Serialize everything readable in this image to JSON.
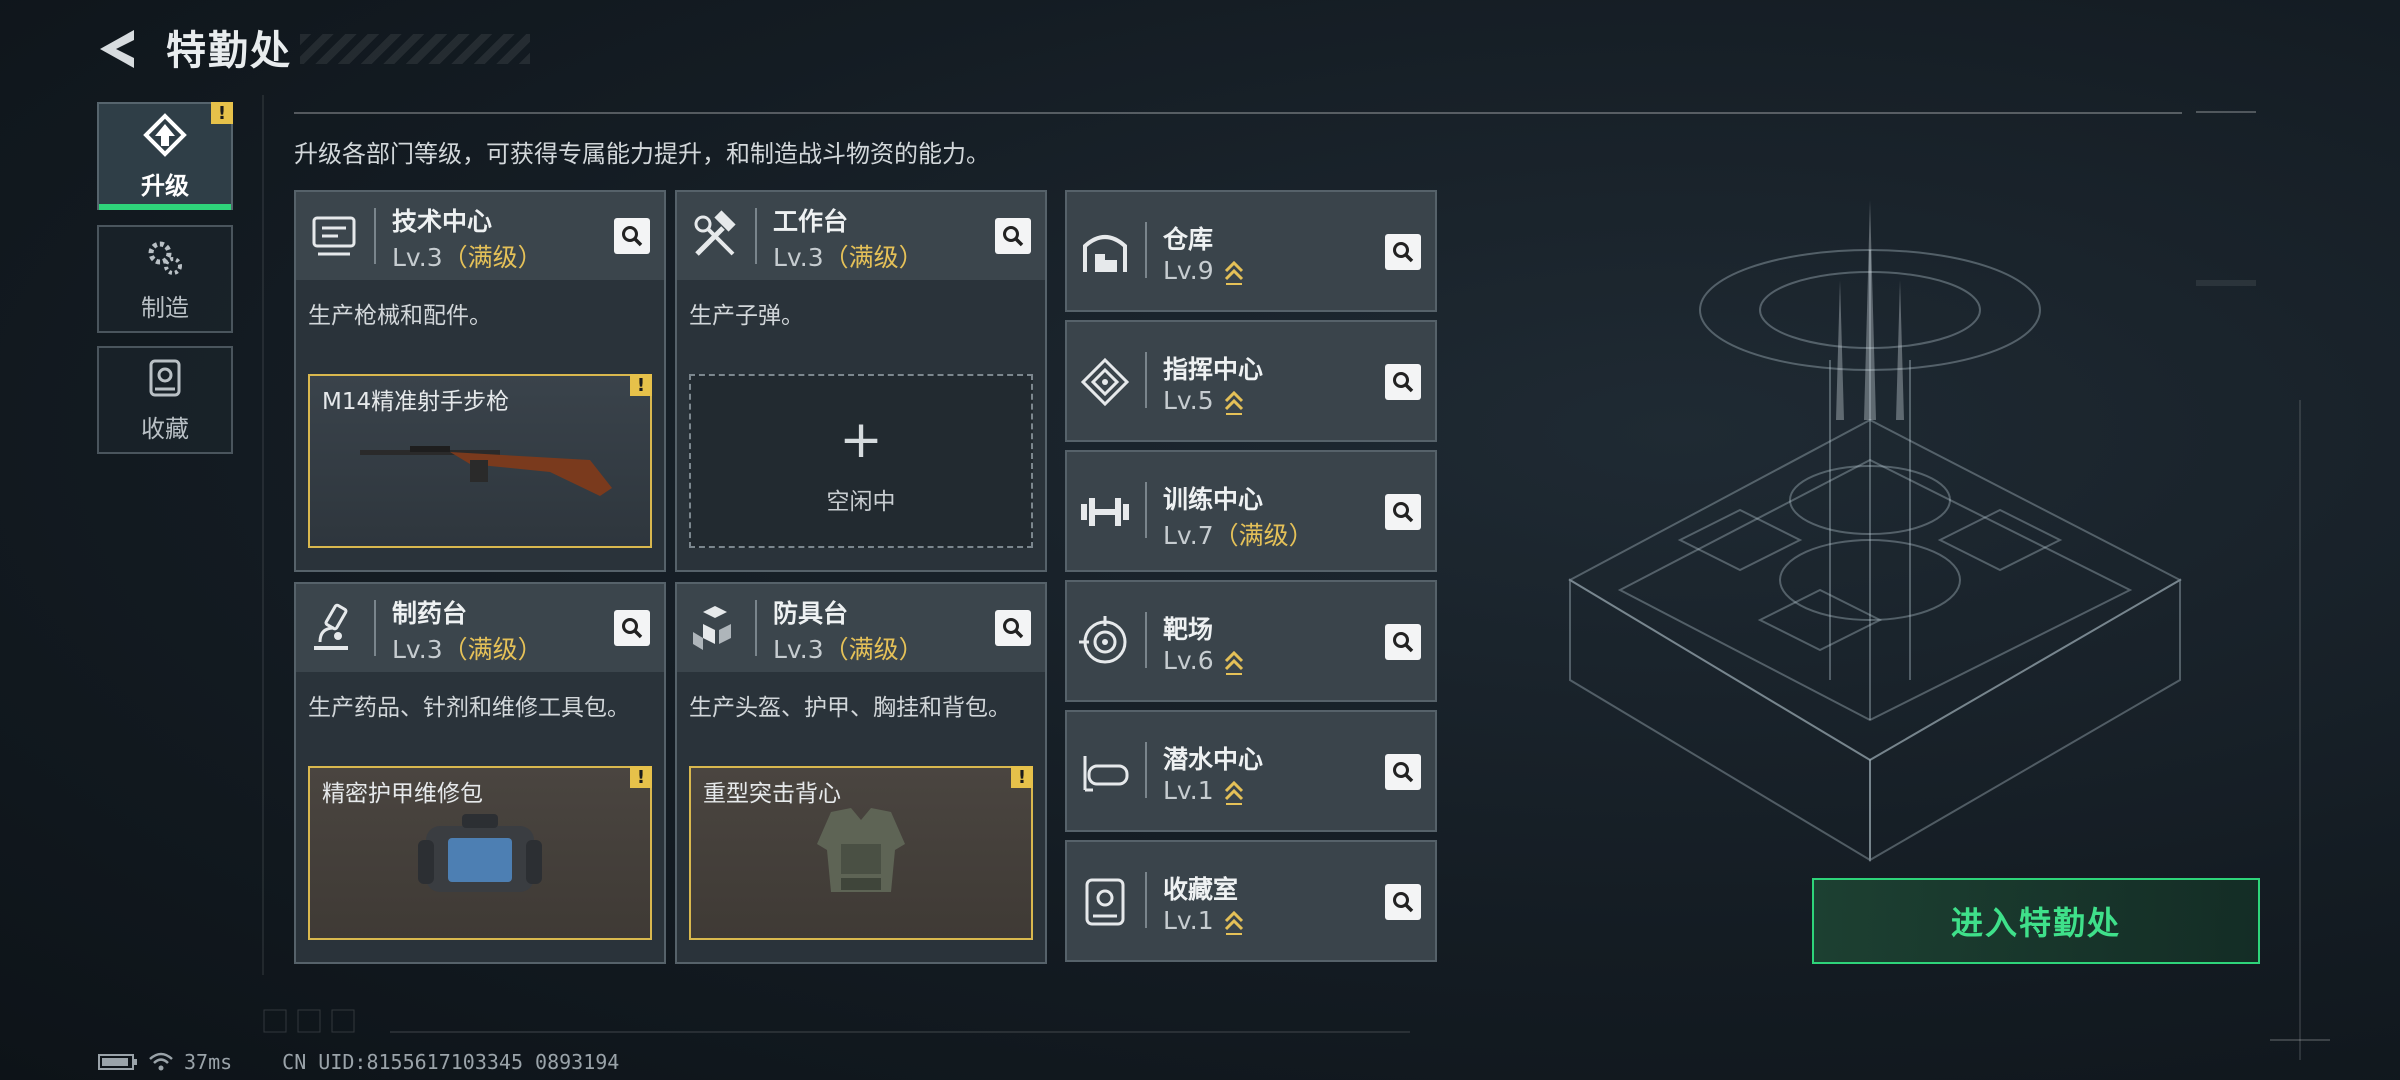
{
  "header": {
    "title": "特勤处"
  },
  "side_tabs": [
    {
      "label": "升级",
      "icon": "upgrade-icon",
      "active": true
    },
    {
      "label": "制造",
      "icon": "gears-icon",
      "active": false
    },
    {
      "label": "收藏",
      "icon": "collection-icon",
      "active": false
    }
  ],
  "subtitle": "升级各部门等级，可获得专属能力提升，和制造战斗物资的能力。",
  "cards": [
    {
      "name": "技术中心",
      "level": "Lv.3",
      "max": "（满级）",
      "icon": "tech-center-icon",
      "desc": "生产枪械和配件。",
      "slot_name": "M14精准射手步枪",
      "slot_state": "item"
    },
    {
      "name": "工作台",
      "level": "Lv.3",
      "max": "（满级）",
      "icon": "workbench-icon",
      "desc": "生产子弹。",
      "slot_name": "空闲中",
      "slot_state": "empty",
      "plus": "+"
    },
    {
      "name": "制药台",
      "level": "Lv.3",
      "max": "（满级）",
      "icon": "pharmacy-icon",
      "desc": "生产药品、针剂和维修工具包。",
      "slot_name": "精密护甲维修包",
      "slot_state": "item"
    },
    {
      "name": "防具台",
      "level": "Lv.3",
      "max": "（满级）",
      "icon": "armor-bench-icon",
      "desc": "生产头盔、护甲、胸挂和背包。",
      "slot_name": "重型突击背心",
      "slot_state": "item"
    }
  ],
  "rows": [
    {
      "name": "仓库",
      "level": "Lv.9",
      "max": "",
      "icon": "warehouse-icon",
      "upgradable": true
    },
    {
      "name": "指挥中心",
      "level": "Lv.5",
      "max": "",
      "icon": "command-center-icon",
      "upgradable": true
    },
    {
      "name": "训练中心",
      "level": "Lv.7",
      "max": "（满级）",
      "icon": "training-center-icon",
      "upgradable": false
    },
    {
      "name": "靶场",
      "level": "Lv.6",
      "max": "",
      "icon": "range-icon",
      "upgradable": true
    },
    {
      "name": "潜水中心",
      "level": "Lv.1",
      "max": "",
      "icon": "diving-center-icon",
      "upgradable": true
    },
    {
      "name": "收藏室",
      "level": "Lv.1",
      "max": "",
      "icon": "collection-room-icon",
      "upgradable": true
    }
  ],
  "enter_button": "进入特勤处",
  "footer": {
    "ping": "37ms",
    "uid": "CN UID:8155617103345 0893194"
  },
  "warn_glyph": "!",
  "colors": {
    "accent": "#2ed47a",
    "max_level": "#e5c158",
    "warning": "#e6c14a"
  }
}
